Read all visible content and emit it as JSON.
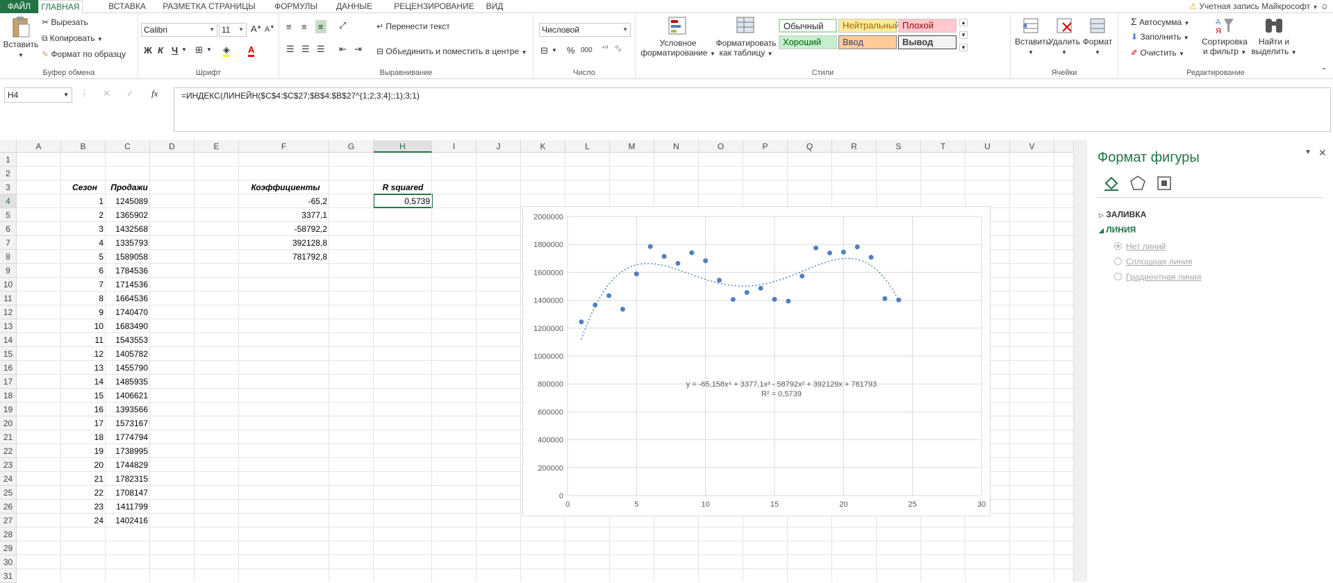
{
  "tabs": [
    "ФАЙЛ",
    "ГЛАВНАЯ",
    "ВСТАВКА",
    "РАЗМЕТКА СТРАНИЦЫ",
    "ФОРМУЛЫ",
    "ДАННЫЕ",
    "РЕЦЕНЗИРОВАНИЕ",
    "ВИД"
  ],
  "account": "Учетная запись Майкрософт",
  "ribbon": {
    "clipboard": {
      "paste": "Вставить",
      "cut": "Вырезать",
      "copy": "Копировать",
      "format_painter": "Формат по образцу",
      "label": "Буфер обмена"
    },
    "font": {
      "name": "Calibri",
      "size": "11",
      "bold": "Ж",
      "italic": "К",
      "underline": "Ч",
      "label": "Шрифт"
    },
    "alignment": {
      "wrap": "Перенести текст",
      "merge": "Объединить и поместить в центре",
      "label": "Выравнивание"
    },
    "number": {
      "format": "Числовой",
      "percent": "%",
      "thousands": "000",
      "label": "Число"
    },
    "styles": {
      "conditional": [
        "Условное",
        "форматирование"
      ],
      "as_table": [
        "Форматировать",
        "как таблицу"
      ],
      "cells": [
        "Обычный",
        "Нейтральный",
        "Плохой",
        "Хороший",
        "Ввод",
        "Вывод"
      ],
      "label": "Стили"
    },
    "cells": {
      "insert": "Вставить",
      "delete": "Удалить",
      "format": "Формат",
      "label": "Ячейки"
    },
    "editing": {
      "autosum": "Автосумма",
      "fill": "Заполнить",
      "clear": "Очистить",
      "sort": [
        "Сортировка",
        "и фильтр"
      ],
      "find": [
        "Найти и",
        "выделить"
      ],
      "label": "Редактирование"
    }
  },
  "formula_bar": {
    "name_box": "H4",
    "fx": "fx",
    "formula": "=ИНДЕКС(ЛИНЕЙН($C$4:$C$27;$B$4:$B$27^{1;2;3;4};;1);3;1)"
  },
  "columns": [
    "A",
    "B",
    "C",
    "D",
    "E",
    "F",
    "G",
    "H",
    "I",
    "J",
    "K",
    "L",
    "M",
    "N",
    "O",
    "P",
    "Q",
    "R",
    "S",
    "T",
    "U",
    "V"
  ],
  "rows": [
    "1",
    "2",
    "3",
    "4",
    "5",
    "6",
    "7",
    "8",
    "9",
    "10",
    "11",
    "12",
    "13",
    "14",
    "15",
    "16",
    "17",
    "18",
    "19",
    "20",
    "21",
    "22",
    "23",
    "24",
    "25",
    "26",
    "27",
    "28",
    "29",
    "30",
    "31"
  ],
  "sheet": {
    "season_header": "Сезон",
    "sales_header": "Продажи",
    "coef_header": "Коэффициенты",
    "r2_header": "R squared",
    "r2_value": "0,5739",
    "seasons": [
      "1",
      "2",
      "3",
      "4",
      "5",
      "6",
      "7",
      "8",
      "9",
      "10",
      "11",
      "12",
      "13",
      "14",
      "15",
      "16",
      "17",
      "18",
      "19",
      "20",
      "21",
      "22",
      "23",
      "24"
    ],
    "sales": [
      "1245089",
      "1365902",
      "1432568",
      "1335793",
      "1589058",
      "1784536",
      "1714536",
      "1664536",
      "1740470",
      "1683490",
      "1543553",
      "1405782",
      "1455790",
      "1485935",
      "1406621",
      "1393566",
      "1573167",
      "1774794",
      "1738995",
      "1744829",
      "1782315",
      "1708147",
      "1411799",
      "1402416"
    ],
    "coefficients": [
      "-65,2",
      "3377,1",
      "-58792,2",
      "392128,8",
      "781792,8"
    ]
  },
  "chart_data": {
    "type": "scatter",
    "x": [
      1,
      2,
      3,
      4,
      5,
      6,
      7,
      8,
      9,
      10,
      11,
      12,
      13,
      14,
      15,
      16,
      17,
      18,
      19,
      20,
      21,
      22,
      23,
      24
    ],
    "y": [
      1245089,
      1365902,
      1432568,
      1335793,
      1589058,
      1784536,
      1714536,
      1664536,
      1740470,
      1683490,
      1543553,
      1405782,
      1455790,
      1485935,
      1406621,
      1393566,
      1573167,
      1774794,
      1738995,
      1744829,
      1782315,
      1708147,
      1411799,
      1402416
    ],
    "xlim": [
      0,
      30
    ],
    "ylim": [
      0,
      2000000
    ],
    "xticks": [
      "0",
      "5",
      "10",
      "15",
      "20",
      "25",
      "30"
    ],
    "yticks": [
      "0",
      "200000",
      "400000",
      "600000",
      "800000",
      "1000000",
      "1200000",
      "1400000",
      "1600000",
      "1800000",
      "2000000"
    ],
    "trendline": {
      "type": "polynomial",
      "order": 4,
      "coefficients": [
        -65.158,
        3377.1,
        -58792,
        392129,
        781793
      ]
    },
    "equation": "y = -65,158x⁴ + 3377,1x³ - 58792x² + 392129x + 781793",
    "r2_label": "R² = 0,5739",
    "grid": true,
    "point_color": "#4f81bd"
  },
  "pane": {
    "title": "Формат фигуры",
    "fill_section": "ЗАЛИВКА",
    "line_section": "ЛИНИЯ",
    "options": [
      "Нет линий",
      "Сплошная линия",
      "Градиентная линия"
    ]
  },
  "colors": {
    "accent": "#217346",
    "neutral": "#ffeb9c",
    "bad": "#ffc7ce",
    "good": "#c6efce",
    "input": "#ffcc99",
    "output": "#f2f2f2"
  }
}
